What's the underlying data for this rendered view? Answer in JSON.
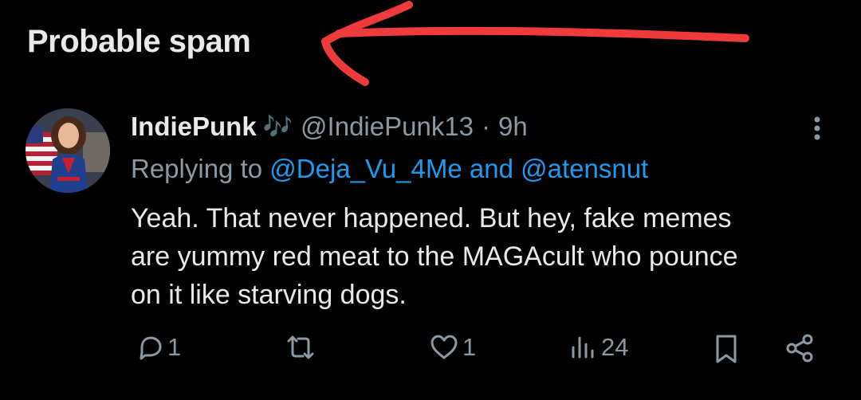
{
  "section": {
    "title": "Probable spam"
  },
  "annotation": {
    "color": "#ef3b3b"
  },
  "tweet": {
    "display_name": "IndiePunk",
    "name_emoji": "🎶",
    "handle": "@IndiePunk13",
    "separator": "·",
    "time": "9h",
    "replying_prefix": "Replying to",
    "replying_to_1": "@Deja_Vu_4Me",
    "replying_conjunction": "and",
    "replying_to_2": "@atensnut",
    "text_lines": [
      "Yeah. That never happened. But hey, fake memes",
      "are yummy red meat to the MAGAcult who pounce",
      "on it like starving dogs."
    ]
  },
  "actions": {
    "reply_count": "1",
    "repost_count": "",
    "like_count": "1",
    "views_count": "24"
  },
  "colors": {
    "background": "#000000",
    "text": "#e7e9ea",
    "muted": "#8b98a5",
    "link": "#1d9bf0"
  }
}
